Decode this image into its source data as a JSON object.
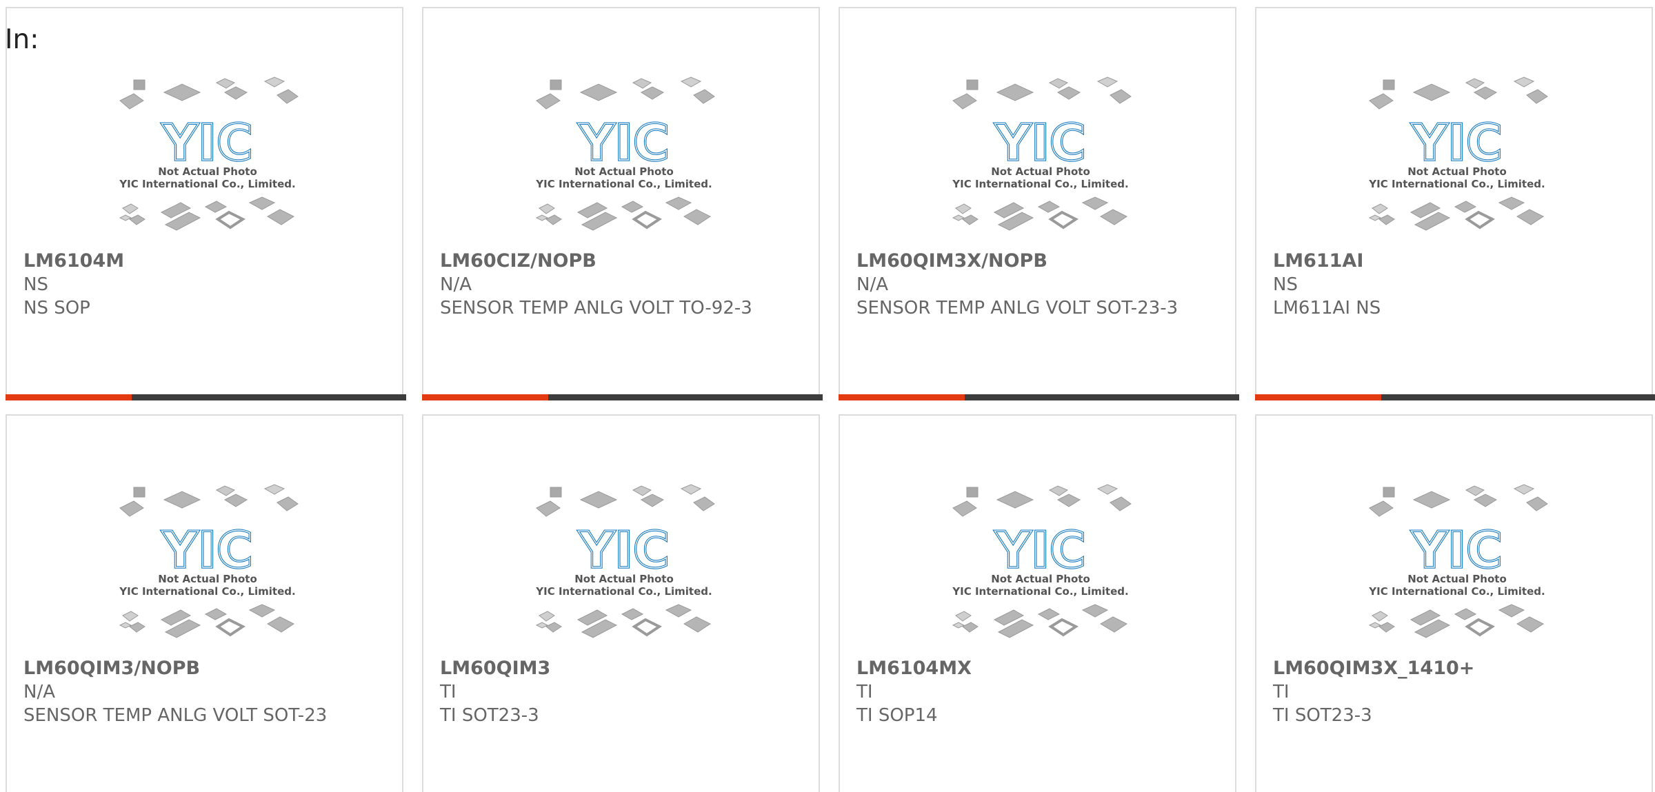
{
  "header": {
    "label": "In:"
  },
  "products": [
    {
      "part": "LM6104M",
      "manufacturer": "NS",
      "description": "NS SOP"
    },
    {
      "part": "LM60CIZ/NOPB",
      "manufacturer": "N/A",
      "description": "SENSOR TEMP ANLG VOLT TO-92-3"
    },
    {
      "part": "LM60QIM3X/NOPB",
      "manufacturer": "N/A",
      "description": "SENSOR TEMP ANLG VOLT SOT-23-3"
    },
    {
      "part": "LM611AI",
      "manufacturer": "NS",
      "description": "LM611AI NS"
    },
    {
      "part": "LM60QIM3/NOPB",
      "manufacturer": "N/A",
      "description": "SENSOR TEMP ANLG VOLT SOT-23"
    },
    {
      "part": "LM60QIM3",
      "manufacturer": "TI",
      "description": "TI SOT23-3"
    },
    {
      "part": "LM6104MX",
      "manufacturer": "TI",
      "description": "TI SOP14"
    },
    {
      "part": "LM60QIM3X_1410+",
      "manufacturer": "TI",
      "description": "TI SOT23-3"
    }
  ],
  "placeholder_image": {
    "logo_text": "YIC",
    "line1": "Not Actual Photo",
    "line2": "YIC International Co., Limited."
  },
  "colors": {
    "accent": "#e23b12",
    "bar": "#3d3d3d",
    "logo_blue": "#1f7fc3",
    "text": "#666666",
    "border": "#dcdcdc"
  }
}
